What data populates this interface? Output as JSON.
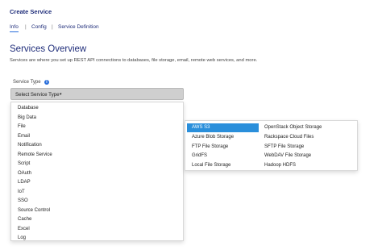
{
  "header": {
    "title": "Create Service",
    "tabs": [
      {
        "label": "Info",
        "active": true
      },
      {
        "label": "Config",
        "active": false
      },
      {
        "label": "Service Definition",
        "active": false
      }
    ],
    "separator": "|"
  },
  "main": {
    "page_title": "Services Overview",
    "description": "Services are where you set up REST API connections to databases, file storage, email, remote web services, and more.",
    "service_type_label": "Service Type",
    "info_icon": "info-circle-icon",
    "info_glyph": "i",
    "select": {
      "value": "Select Service Type",
      "caret": "▾"
    }
  },
  "menu": {
    "items": [
      "Database",
      "Big Data",
      "File",
      "Email",
      "Notification",
      "Remote Service",
      "Script",
      "OAuth",
      "LDAP",
      "IoT",
      "SSO",
      "Source Control",
      "Cache",
      "Excel",
      "Log"
    ]
  },
  "submenu": {
    "left": [
      "AWS S3",
      "Azure Blob Storage",
      "FTP File Storage",
      "GridFS",
      "Local File Storage"
    ],
    "right": [
      "OpenStack Object Storage",
      "Rackspace Cloud Files",
      "SFTP File Storage",
      "WebDAV File Storage",
      "Hadoop HDFS"
    ],
    "active_item": "AWS S3",
    "active_color": "#2a8fdb"
  },
  "colors": {
    "title": "#1f2d7a",
    "accent": "#2a6fdb",
    "select_bg": "#cfcfcf"
  }
}
